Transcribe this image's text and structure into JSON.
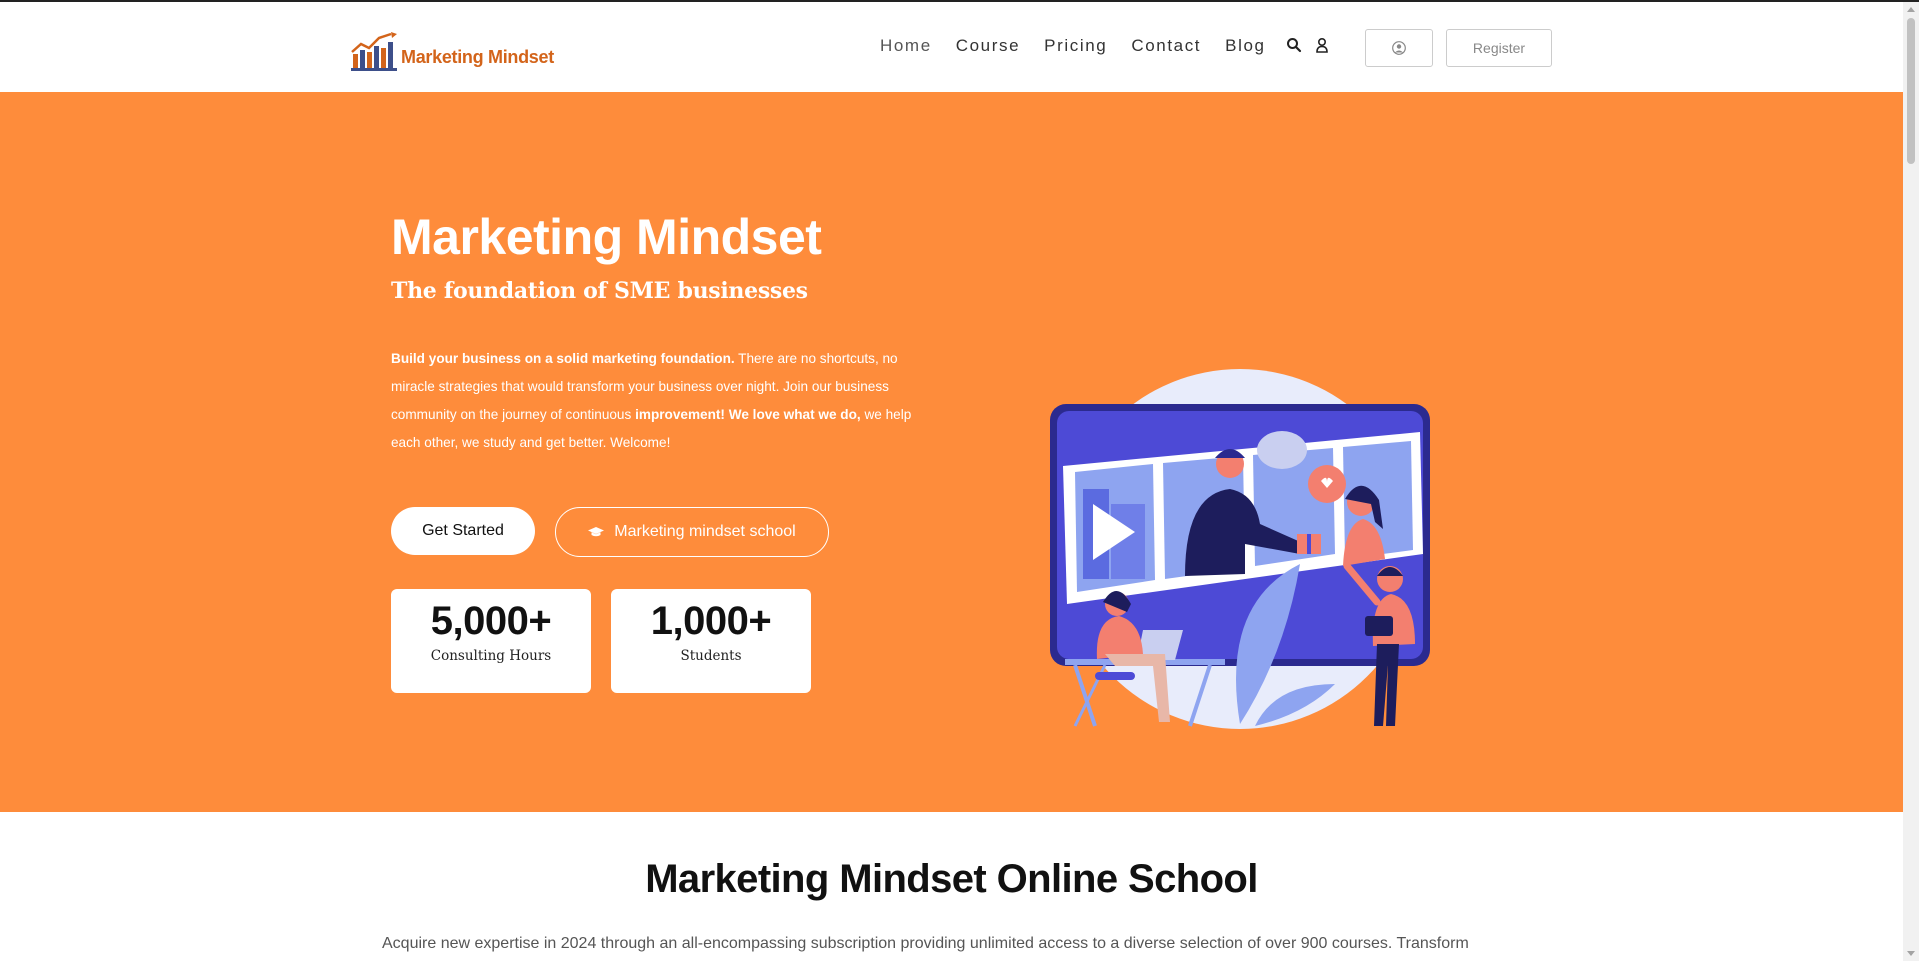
{
  "header": {
    "logo_text": "Marketing Mindset",
    "nav": [
      {
        "label": "Home",
        "active": true
      },
      {
        "label": "Course"
      },
      {
        "label": "Pricing"
      },
      {
        "label": "Contact"
      },
      {
        "label": "Blog"
      }
    ],
    "icons": [
      "search-icon",
      "user-icon"
    ],
    "login_icon": "user-circle-icon",
    "register_label": "Register"
  },
  "hero": {
    "title": "Marketing Mindset",
    "subtitle": "The foundation of SME businesses",
    "desc_bold_1": "Build your business on a solid marketing foundation.",
    "desc_1": " There are no shortcuts, no miracle strategies that would transform your business over night. Join our business community on the journey of continuous ",
    "desc_bold_2": "improvement! We love what we do,",
    "desc_2": " we help each other, we study and get better. Welcome!",
    "btn_start": "Get Started",
    "btn_school": "Marketing mindset school",
    "btn_school_icon": "graduation-cap-icon",
    "stats": [
      {
        "value": "5,000+",
        "label": "Consulting Hours"
      },
      {
        "value": "1,000+",
        "label": "Students"
      }
    ],
    "illustration": "online-meeting-illustration"
  },
  "school": {
    "title": "Marketing Mindset Online School",
    "text": "Acquire new expertise in 2024 through an all-encompassing subscription providing unlimited access to a diverse selection of over 900 courses. Transform"
  },
  "colors": {
    "hero_bg": "#fe8c3b",
    "logo": "#d3641a",
    "illustration_purple": "#4d4ad6"
  }
}
